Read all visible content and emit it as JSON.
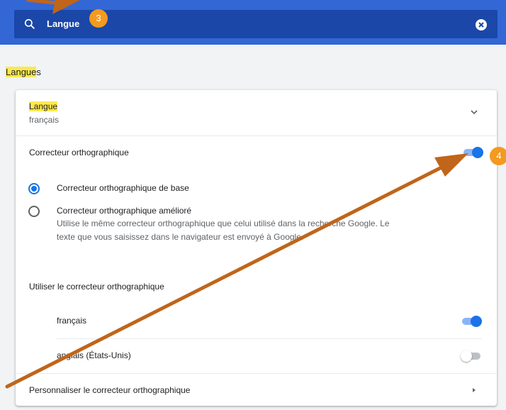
{
  "search": {
    "value": "Langue",
    "badge": "3"
  },
  "section": {
    "title_highlight": "Langue",
    "title_rest": "s"
  },
  "language_row": {
    "label": "Langue",
    "value": "français"
  },
  "spellcheck": {
    "label": "Correcteur orthographique",
    "enabled": true,
    "badge": "4",
    "options": {
      "basic": "Correcteur orthographique de base",
      "enhanced": "Correcteur orthographique amélioré",
      "enhanced_description": "Utilise le même correcteur orthographique que celui utilisé dans la recherche Google. Le texte que vous saisissez dans le navigateur est envoyé à Google.",
      "selected": "basic"
    },
    "use_for_label": "Utiliser le correcteur orthographique",
    "languages": [
      {
        "name": "français",
        "enabled": true
      },
      {
        "name": "anglais (États-Unis)",
        "enabled": false
      }
    ],
    "customize_label": "Personnaliser le correcteur orthographique"
  },
  "colors": {
    "header": "#3367d6",
    "accent": "#1a73e8",
    "highlight": "#fce94f",
    "annotation": "#c0651a",
    "badge": "#f39a1f"
  }
}
